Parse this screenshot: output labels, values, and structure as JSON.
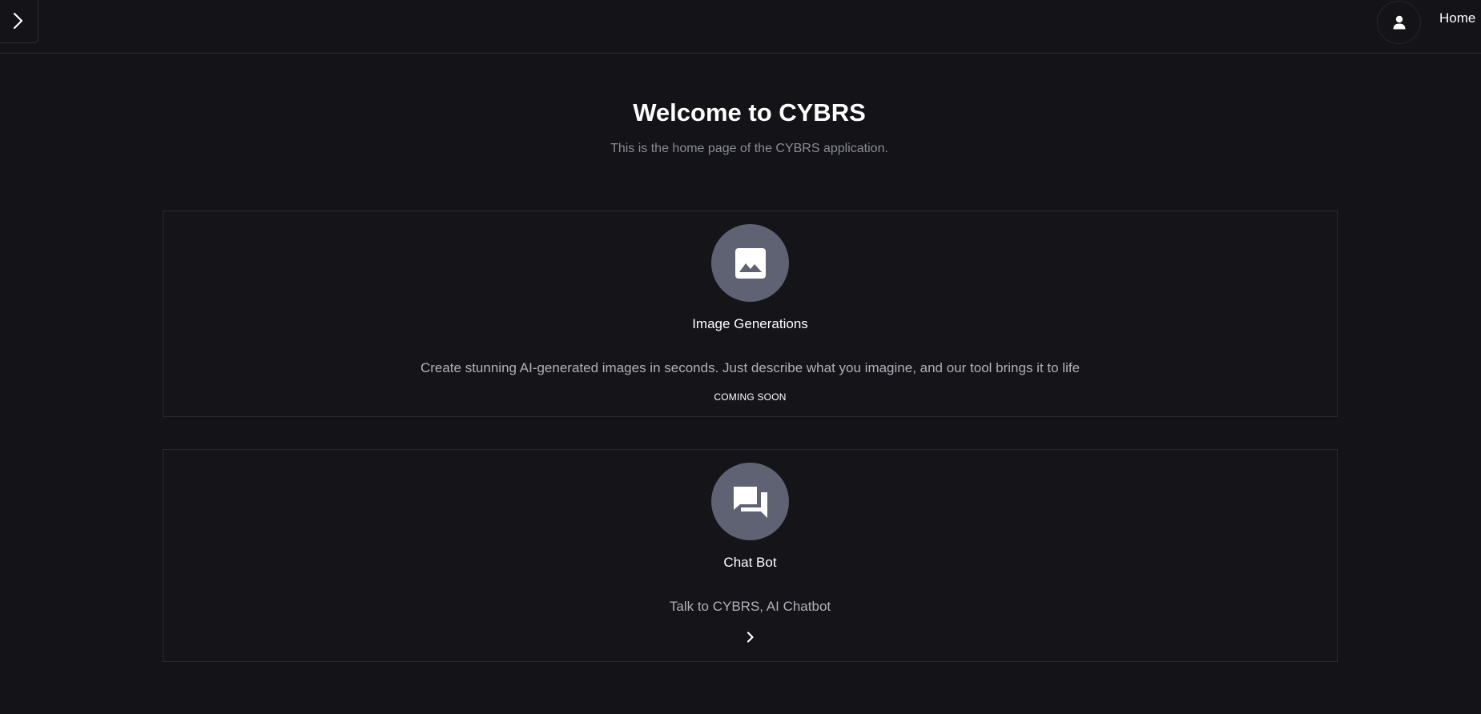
{
  "header": {
    "nav_link": "Home",
    "icons": {
      "sidebar_toggle": "chevron-right-icon",
      "account": "user-icon"
    }
  },
  "main": {
    "title": "Welcome to CYBRS",
    "subtitle": "This is the home page of the CYBRS application."
  },
  "cards": [
    {
      "title": "Image Generations",
      "description": "Create stunning AI-generated images in seconds. Just describe what you imagine, and our tool brings it to life",
      "status": "COMING SOON",
      "icon": "image-icon"
    },
    {
      "title": "Chat Bot",
      "description": "Talk to CYBRS, AI Chatbot",
      "icon": "chat-icon",
      "action_icon": "chevron-right-icon"
    }
  ],
  "colors": {
    "background": "#131318",
    "border": "#2a2a31",
    "icon_circle": "#5f6272",
    "muted_text": "#8a8b94"
  }
}
